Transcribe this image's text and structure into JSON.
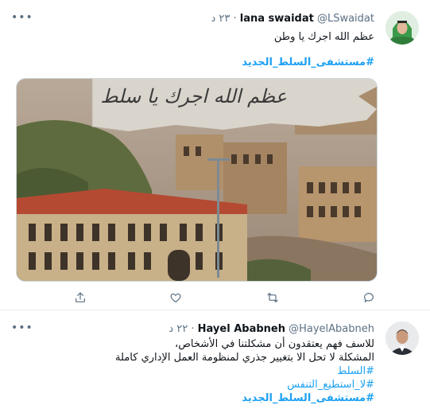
{
  "tweet1": {
    "name": "lana swaidat",
    "handle": "@LSwaidat",
    "dot": "·",
    "time": "٢٣ د",
    "text": "عظم الله اجرك يا وطن",
    "hashtag": "#مستشفى_السلط_الجديد",
    "image_caption": "عظم الله اجرك يا سلط"
  },
  "tweet2": {
    "name": "Hayel Ababneh",
    "handle": "@HayelAbabneh",
    "dot": "·",
    "time": "٢٢ د",
    "line1": "للاسف فهم يعتقدون أن مشكلتنا في الأشخاص،",
    "line2": "المشكلة لا تحل الا بتغيير جذري لمنظومة العمل الإداري كاملة",
    "hashtag1": "#السلط",
    "hashtag2": "#لا_استطيع_التنفس",
    "hashtag3": "#مستشفى_السلط_الجديد"
  },
  "icons": [
    "more-icon",
    "reply-icon",
    "retweet-icon",
    "like-icon",
    "share-icon"
  ],
  "colors": {
    "link": "#1da1f2",
    "secondary": "#5b7083"
  }
}
